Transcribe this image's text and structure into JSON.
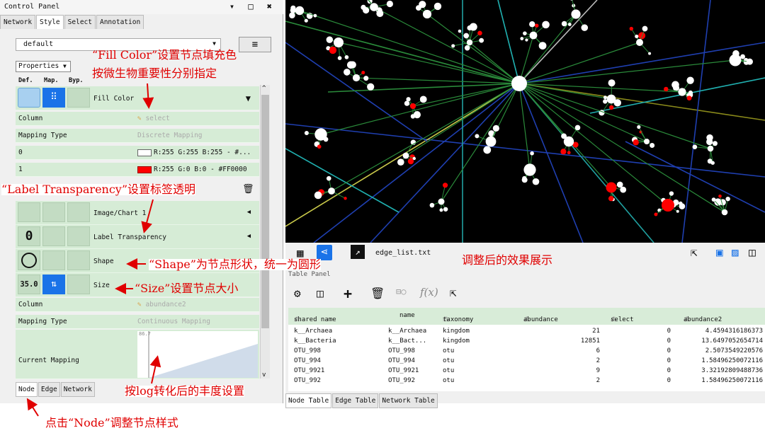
{
  "control_panel": {
    "title": "Control Panel",
    "window_controls": "▾ □ ✖",
    "tabs": [
      "Network",
      "Style",
      "Select",
      "Annotation"
    ],
    "active_tab": "Style",
    "style_name": "default",
    "properties_label": "Properties",
    "col_headers": {
      "def": "Def.",
      "map": "Map.",
      "byp": "Byp."
    },
    "fill_color": {
      "label": "Fill Color",
      "column_key": "Column",
      "column_value": "select",
      "mapping_type_key": "Mapping Type",
      "mapping_type_value": "Discrete Mapping",
      "rows": [
        {
          "key": "0",
          "value": "R:255 G:255 B:255 - #...",
          "swatch": "#ffffff"
        },
        {
          "key": "1",
          "value": "R:255 G:0 B:0 - #FF0000",
          "swatch": "#ff0000"
        }
      ]
    },
    "image_chart": {
      "label": "Image/Chart 1"
    },
    "label_transparency": {
      "label": "Label Transparency",
      "def_value": "0"
    },
    "shape": {
      "label": "Shape"
    },
    "size": {
      "label": "Size",
      "def_value": "35.0",
      "column_key": "Column",
      "column_value": "abundance2",
      "mapping_type_key": "Mapping Type",
      "mapping_type_value": "Continuous Mapping",
      "current_mapping_key": "Current Mapping",
      "mapping_max": "86.7"
    },
    "bottom_tabs": [
      "Node",
      "Edge",
      "Network"
    ],
    "active_bottom_tab": "Node"
  },
  "network_view": {
    "file_name": "edge_list.txt"
  },
  "table_panel": {
    "title": "Table Panel",
    "columns": [
      "shared name",
      "name",
      "taxonomy",
      "abundance",
      "select",
      "abundance2"
    ],
    "rows": [
      [
        "k__Archaea",
        "k__Archaea",
        "kingdom",
        "21",
        "0",
        "4.4594316186373"
      ],
      [
        "k__Bacteria",
        "k__Bact...",
        "kingdom",
        "12851",
        "0",
        "13.6497052654714"
      ],
      [
        "OTU_998",
        "OTU_998",
        "otu",
        "6",
        "0",
        "2.5073549220576"
      ],
      [
        "OTU_994",
        "OTU_994",
        "otu",
        "2",
        "0",
        "1.58496250072116"
      ],
      [
        "OTU_9921",
        "OTU_9921",
        "otu",
        "9",
        "0",
        "3.32192809488736"
      ],
      [
        "OTU_992",
        "OTU_992",
        "otu",
        "2",
        "0",
        "1.58496250072116"
      ]
    ],
    "tabs": [
      "Node Table",
      "Edge Table",
      "Network Table"
    ]
  },
  "annotations": {
    "fill_color_line1": "“Fill Color”设置节点填充色",
    "fill_color_line2": "按微生物重要性分别指定",
    "label_transparency": "“Label Transparency”设置标签透明",
    "shape": "“Shape”为节点形状，统一为圆形",
    "size": "“Size”设置节点大小",
    "effect": "调整后的效果展示",
    "log_abundance": "按log转化后的丰度设置",
    "node_click": "点击“Node”调整节点样式"
  },
  "colors": {
    "accent_blue": "#1a73e8",
    "row_green": "#d6ecd6",
    "annotation_red": "#e00000"
  }
}
